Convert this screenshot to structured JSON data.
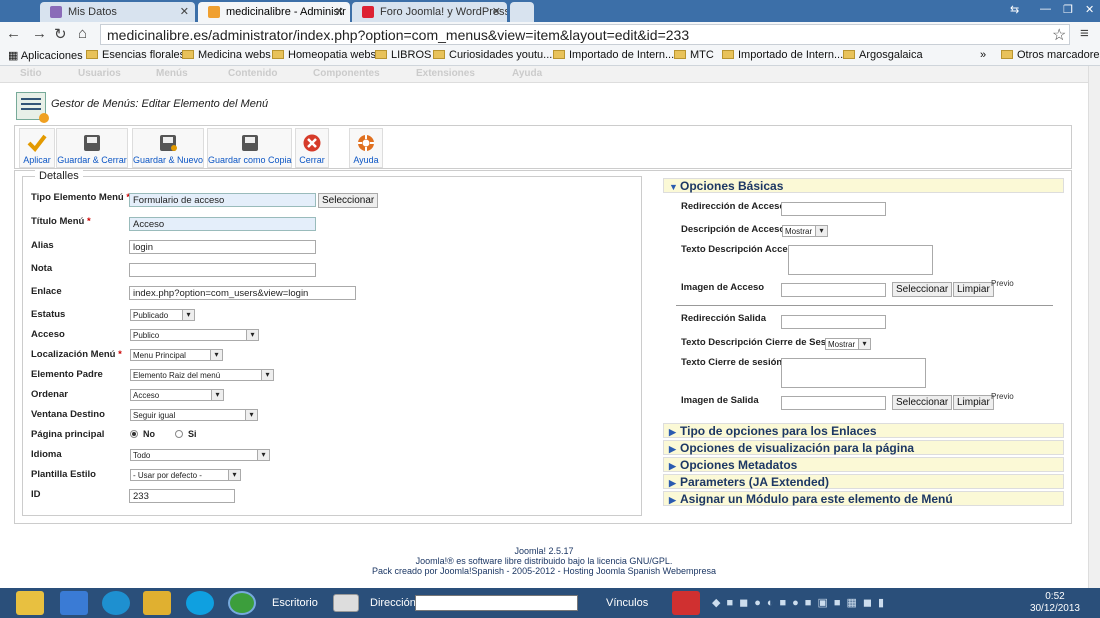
{
  "browser": {
    "tabs": [
      {
        "label": "Mis Datos"
      },
      {
        "label": "medicinalibre - Administr"
      },
      {
        "label": "Foro Joomla! y WordPress"
      }
    ],
    "url": "medicinalibre.es/administrator/index.php?option=com_menus&view=item&layout=edit&id=233",
    "bookmarks": [
      "Aplicaciones",
      "Esencias florales",
      "Medicina webs",
      "Homeopatia webs",
      "LIBROS",
      "Curiosidades youtu...",
      "Importado de Intern...",
      "MTC",
      "Importado de Intern...",
      "Argosgalaica",
      "Otros marcadores"
    ],
    "overflow": "»"
  },
  "joomla_menu": [
    "Sitio",
    "Usuarios",
    "Menús",
    "Contenido",
    "Componentes",
    "Extensiones",
    "Ayuda"
  ],
  "page_title": "Gestor de Menús: Editar Elemento del Menú",
  "toolbar": {
    "apply": "Aplicar",
    "save_close": "Guardar & Cerrar",
    "save_new": "Guardar & Nuevo",
    "save_copy": "Guardar como Copia",
    "close": "Cerrar",
    "help": "Ayuda"
  },
  "details": {
    "legend": "Detalles",
    "req": "*",
    "tipo_label": "Tipo Elemento Menú",
    "tipo_value": "Formulario de acceso",
    "select_btn": "Seleccionar",
    "titulo_label": "Título Menú",
    "titulo_value": "Acceso",
    "alias_label": "Alias",
    "alias_value": "login",
    "nota_label": "Nota",
    "nota_value": "",
    "enlace_label": "Enlace",
    "enlace_value": "index.php?option=com_users&view=login",
    "estatus_label": "Estatus",
    "estatus_value": "Publicado",
    "acceso_label": "Acceso",
    "acceso_value": "Publico",
    "localizacion_label": "Localización Menú",
    "localizacion_value": "Menu Principal",
    "padre_label": "Elemento Padre",
    "padre_value": "Elemento Raiz del menú",
    "ordenar_label": "Ordenar",
    "ordenar_value": "Acceso",
    "ventana_label": "Ventana Destino",
    "ventana_value": "Seguir igual",
    "principal_label": "Página principal",
    "principal_no": "No",
    "principal_si": "Si",
    "idioma_label": "Idioma",
    "idioma_value": "Todo",
    "plantilla_label": "Plantilla Estilo",
    "plantilla_value": "- Usar por defecto -",
    "id_label": "ID",
    "id_value": "233"
  },
  "basic_options": {
    "header": "Opciones Básicas",
    "redireccion_acceso": "Redirección de Acceso",
    "descripcion_acceso": "Descripción de Acceso",
    "descripcion_acceso_value": "Mostrar",
    "texto_descripcion_acceso": "Texto Descripción Acceso",
    "imagen_acceso": "Imagen de Acceso",
    "seleccionar": "Seleccionar",
    "limpiar": "Limpiar",
    "previo": "Previo",
    "redireccion_salida": "Redirección Salida",
    "texto_desc_cierre": "Texto Descripción Cierre de Sesión",
    "texto_desc_cierre_value": "Mostrar",
    "texto_cierre": "Texto Cierre de sesión",
    "imagen_salida": "Imagen de Salida"
  },
  "panes": [
    "Tipo de opciones para los Enlaces",
    "Opciones de visualización para la página",
    "Opciones Metadatos",
    "Parameters (JA Extended)",
    "Asignar un Módulo para este elemento de Menú"
  ],
  "footer": {
    "line1": "Joomla! 2.5.17",
    "line2": "Joomla!® es software libre distribuido bajo la licencia GNU/GPL.",
    "line3": "Pack creado por Joomla!Spanish - 2005-2012 - Hosting Joomla Spanish Webempresa"
  },
  "taskbar": {
    "escritorio": "Escritorio",
    "direccion": "Dirección",
    "vinculos": "Vínculos",
    "time": "0:52",
    "date": "30/12/2013"
  }
}
